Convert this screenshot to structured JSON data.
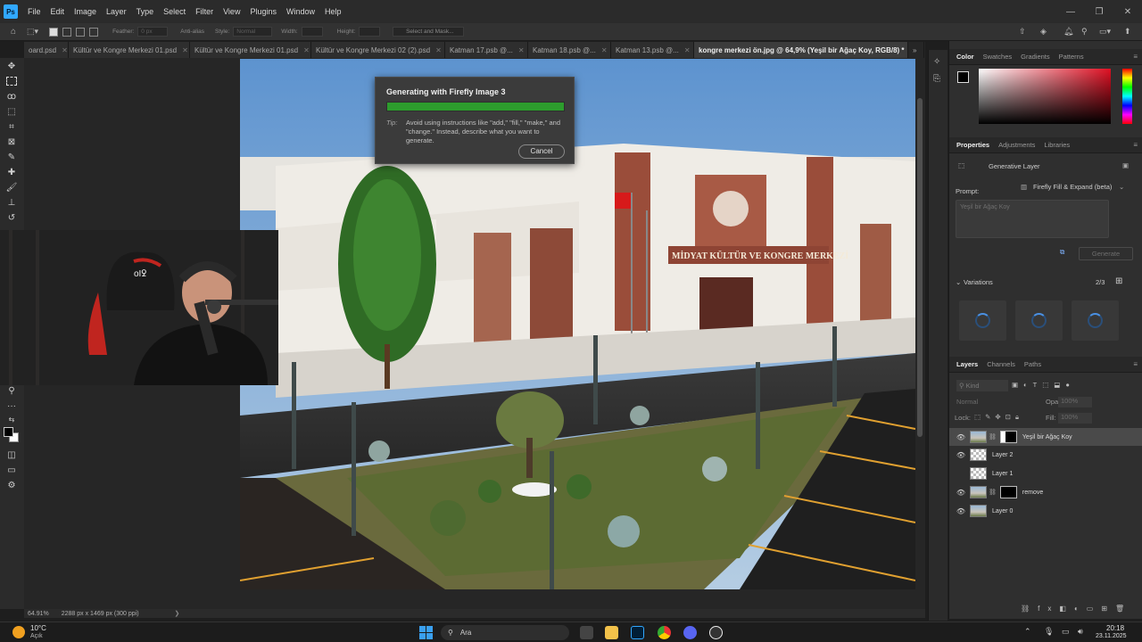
{
  "menubar": {
    "app_logo": "Ps",
    "items": [
      "File",
      "Edit",
      "Image",
      "Layer",
      "Type",
      "Select",
      "Filter",
      "View",
      "Plugins",
      "Window",
      "Help"
    ]
  },
  "options_bar": {
    "feather_label": "Feather:",
    "feather_value": "0 px",
    "anti_alias": "Anti-alias",
    "style_label": "Style:",
    "style_value": "Normal",
    "width_label": "Width:",
    "height_label": "Height:",
    "select_mask_button": "Select and Mask..."
  },
  "tabs": [
    {
      "label": "oard.psd"
    },
    {
      "label": "Kültür ve Kongre Merkezi 01.psd"
    },
    {
      "label": "Kültür ve Kongre Merkezi 01.psd"
    },
    {
      "label": "Kültür ve Kongre Merkezi 02 (2).psd"
    },
    {
      "label": "Katman 17.psb @..."
    },
    {
      "label": "Katman 18.psb @..."
    },
    {
      "label": "Katman 13.psb @..."
    },
    {
      "label": "kongre merkezi ön.jpg @ 64,9% (Yeşil bir Ağaç Koy, RGB/8) *"
    }
  ],
  "firefly_dialog": {
    "title": "Generating with Firefly Image 3",
    "progress_percent": 100,
    "tip_label": "Tip:",
    "tip_text": "Avoid using instructions like \"add,\" \"fill,\" \"make,\" and \"change.\" Instead, describe what you want to generate.",
    "cancel_label": "Cancel"
  },
  "photo": {
    "building_sign": "MİDYAT KÜLTÜR VE KONGRE MERKEZİ"
  },
  "status_bar": {
    "zoom": "64.91%",
    "doc_info": "2288 px x 1469 px (300 ppi)"
  },
  "color_panel": {
    "tabs": [
      "Color",
      "Swatches",
      "Gradients",
      "Patterns"
    ],
    "foreground": "#000000",
    "background": "#ffffff",
    "hue": "#e01023"
  },
  "properties_panel": {
    "tabs": [
      "Properties",
      "Adjustments",
      "Libraries"
    ],
    "layer_type": "Generative Layer",
    "prompt_label": "Prompt:",
    "model": "Firefly Fill & Expand (beta)",
    "prompt_value": "Yeşil bir Ağaç Koy",
    "generate_label": "Generate",
    "variations_label": "Variations",
    "variations_count": "2/3"
  },
  "layers_panel": {
    "tabs": [
      "Layers",
      "Channels",
      "Paths"
    ],
    "kind_placeholder": "Kind",
    "blend_mode": "Normal",
    "opacity_label": "Opacity:",
    "opacity_value": "100%",
    "lock_label": "Lock:",
    "fill_label": "Fill:",
    "fill_value": "100%",
    "layers": [
      {
        "name": "Yeşil bir Ağaç Koy",
        "visible": true,
        "selected": true
      },
      {
        "name": "Layer 2",
        "visible": true,
        "selected": false
      },
      {
        "name": "Layer 1",
        "visible": false,
        "selected": false
      },
      {
        "name": "remove",
        "visible": true,
        "selected": false
      },
      {
        "name": "Layer 0",
        "visible": true,
        "selected": false
      }
    ]
  },
  "taskbar": {
    "temperature": "10°C",
    "weather": "Açık",
    "search_placeholder": "Ara",
    "time": "20:18",
    "date": "23.11.2025"
  }
}
